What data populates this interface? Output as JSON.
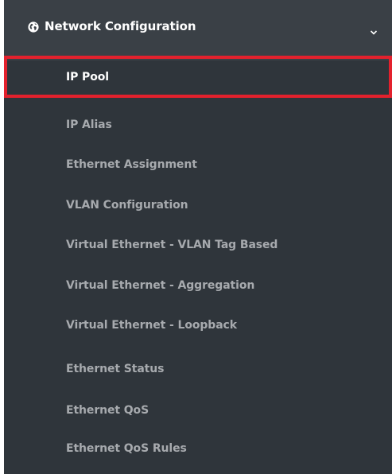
{
  "menu": {
    "header_label": "Network Configuration",
    "header_icon": "globe-icon",
    "expand_icon": "chevron-down-icon",
    "items": [
      {
        "label": "IP Pool",
        "active": true
      },
      {
        "label": "IP Alias"
      },
      {
        "label": "Ethernet Assignment"
      },
      {
        "label": "VLAN Configuration"
      },
      {
        "label": "Virtual Ethernet - VLAN Tag Based"
      },
      {
        "label": "Virtual Ethernet - Aggregation"
      },
      {
        "label": "Virtual Ethernet - Loopback"
      },
      {
        "label": "Ethernet Status"
      },
      {
        "label": "Ethernet QoS"
      },
      {
        "label": "Ethernet QoS Rules"
      }
    ]
  },
  "colors": {
    "panel_bg": "#3a4046",
    "submenu_bg": "#2f353b",
    "active_text": "#ffffff",
    "item_text": "#a7aaae",
    "highlight_border": "#e3212d"
  }
}
